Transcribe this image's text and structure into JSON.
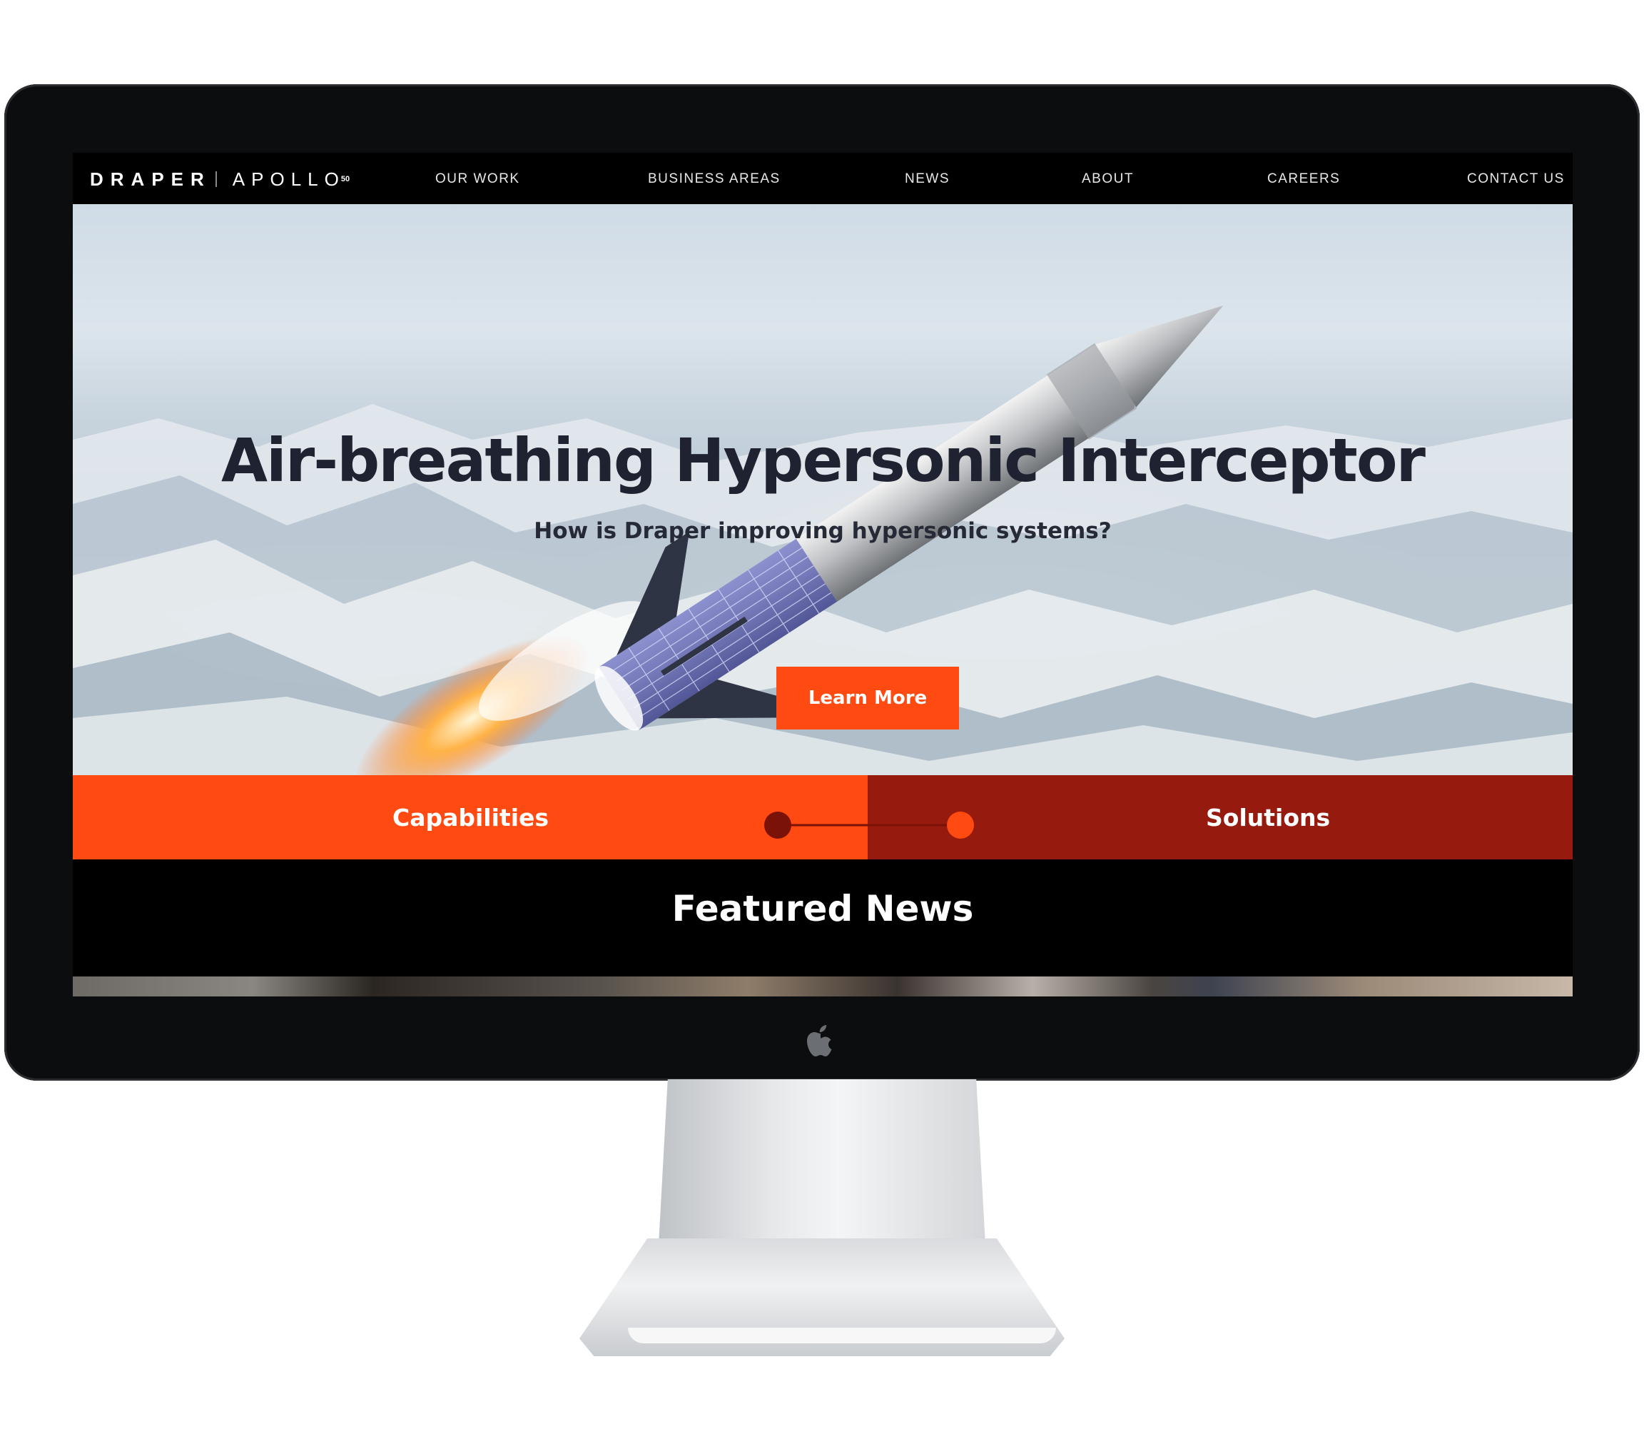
{
  "brand": {
    "name_left": "DRAPER",
    "name_right": "APOLLO",
    "superscript": "50",
    "accent_color": "#ff4a12",
    "dark_red": "#961a0d"
  },
  "nav": {
    "items": [
      {
        "label": "OUR WORK"
      },
      {
        "label": "BUSINESS AREAS"
      },
      {
        "label": "NEWS"
      },
      {
        "label": "ABOUT"
      },
      {
        "label": "CAREERS"
      },
      {
        "label": "CONTACT US"
      }
    ]
  },
  "hero": {
    "title": "Air-breathing Hypersonic Interceptor",
    "subtitle": "How is Draper improving hypersonic systems?",
    "cta_label": "Learn More"
  },
  "split": {
    "left_label": "Capabilities",
    "right_label": "Solutions"
  },
  "featured": {
    "title": "Featured News"
  },
  "icons": {
    "hardware_logo": "apple-icon"
  }
}
